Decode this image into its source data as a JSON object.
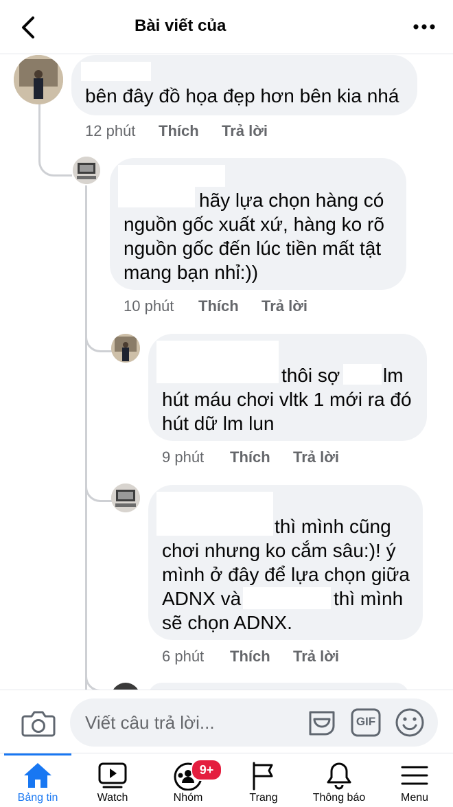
{
  "header": {
    "title": "Bài viết của"
  },
  "comments": [
    {
      "lines": [
        "bên đây đồ họa đẹp hơn bên kia nhá"
      ],
      "time": "12 phút",
      "like": "Thích",
      "reply": "Trả lời"
    },
    {
      "lines": [
        "hãy lựa chọn hàng có",
        "nguồn gốc xuất xứ, hàng ko rõ",
        "nguồn gốc đến lúc tiền mất tật",
        "mang bạn nhỉ:))"
      ],
      "time": "10 phút",
      "like": "Thích",
      "reply": "Trả lời"
    },
    {
      "lines": [
        "thôi sợ",
        "lm",
        "hút máu chơi vltk 1 mới ra đó",
        "hút dữ lm lun"
      ],
      "time": "9 phút",
      "like": "Thích",
      "reply": "Trả lời"
    },
    {
      "lines": [
        "thì mình cũng",
        "chơi nhưng ko cắm sâu:)! ý",
        "mình ở đây để lựa chọn giữa",
        "ADNX và",
        "thì mình",
        "sẽ chọn ADNX."
      ],
      "time": "6 phút",
      "like": "Thích",
      "reply": "Trả lời"
    }
  ],
  "composer": {
    "placeholder": "Viết câu trả lời...",
    "gif": "GIF"
  },
  "nav": {
    "tabs": [
      {
        "label": "Bảng tin",
        "icon": "home-icon",
        "active": true
      },
      {
        "label": "Watch",
        "icon": "watch-icon"
      },
      {
        "label": "Nhóm",
        "icon": "groups-icon",
        "badge": "9+"
      },
      {
        "label": "Trang",
        "icon": "flag-icon"
      },
      {
        "label": "Thông báo",
        "icon": "bell-icon"
      },
      {
        "label": "Menu",
        "icon": "menu-icon"
      }
    ]
  },
  "colors": {
    "accent": "#1877f2",
    "badge": "#e41e3f",
    "bubble": "#f0f2f5",
    "meta": "#65676b"
  }
}
